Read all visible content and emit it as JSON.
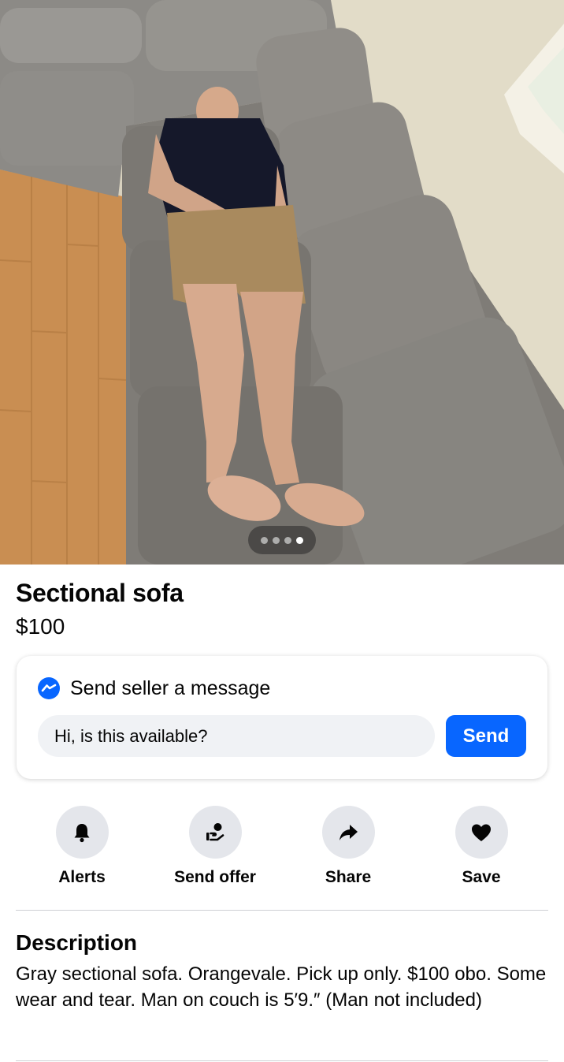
{
  "listing": {
    "title": "Sectional sofa",
    "price": "$100"
  },
  "gallery": {
    "total_images": 4,
    "current_index": 4
  },
  "message_card": {
    "heading": "Send seller a message",
    "input_value": "Hi, is this available?",
    "send_label": "Send",
    "icon": "messenger-icon"
  },
  "actions": [
    {
      "label": "Alerts",
      "icon": "bell-icon"
    },
    {
      "label": "Send offer",
      "icon": "offer-icon"
    },
    {
      "label": "Share",
      "icon": "share-arrow-icon"
    },
    {
      "label": "Save",
      "icon": "heart-icon"
    }
  ],
  "description": {
    "heading": "Description",
    "text": "Gray sectional sofa. Orangevale. Pick up only. $100 obo. Some wear and tear. Man on couch is 5′9.″ (Man not included)"
  },
  "colors": {
    "accent": "#0866ff",
    "icon_bg": "#e4e6eb",
    "input_bg": "#f0f2f5",
    "text": "#050505"
  }
}
